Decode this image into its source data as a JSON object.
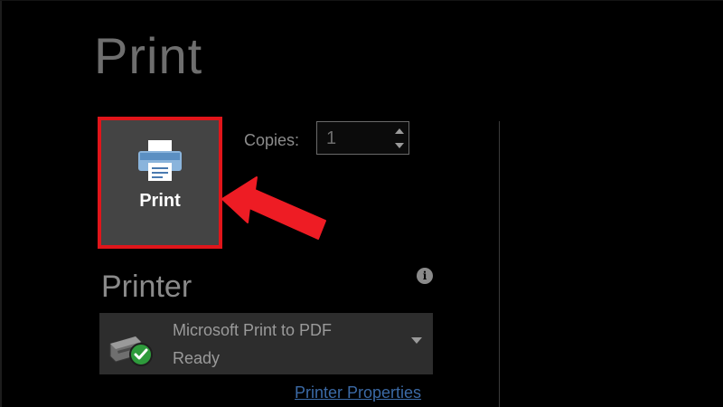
{
  "page": {
    "title": "Print"
  },
  "print_button": {
    "label": "Print",
    "icon": "printer-icon"
  },
  "copies": {
    "label": "Copies:",
    "value": "1"
  },
  "printer_section": {
    "heading": "Printer",
    "info_icon": "info-icon",
    "info_glyph": "i",
    "selected_printer": {
      "name": "Microsoft Print to PDF",
      "status": "Ready",
      "icon": "printer-ready-icon"
    },
    "properties_link": "Printer Properties"
  },
  "colors": {
    "background": "#000000",
    "button_bg": "#444444",
    "highlight": "#e1151a",
    "link": "#3b6aa6",
    "ready_green": "#2e9b3c"
  }
}
